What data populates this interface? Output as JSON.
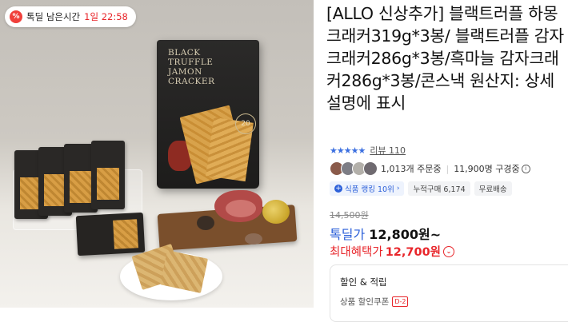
{
  "deal_badge": {
    "icon": "percent-icon",
    "label": "톡딜 남은시간",
    "time": "1일 22:58"
  },
  "product": {
    "title": "[ALLO 신상추가] 블랙트러플 하몽크래커319g*3봉/ 블랙트러플 감자크래커286g*3봉/흑마늘 감자크래커286g*3봉/콘스낵 원산지: 상세설명에 표시",
    "image_text": {
      "bag_title": "BLACK\nTRUFFLE\nJAMON\nCRACKER",
      "seal": "20"
    }
  },
  "rating": {
    "stars": "★★★★★",
    "review_label": "리뷰 110"
  },
  "social": {
    "orders": "1,013개 주문중",
    "browsing": "11,900명 구경중"
  },
  "tags": {
    "ranking": "식품 랭킹 10위",
    "cumulative": "누적구매 6,174",
    "shipping": "무료배송"
  },
  "price": {
    "original": "14,500원",
    "deal_label": "톡딜가",
    "deal_price": "12,800원~",
    "max_label": "최대혜택가",
    "max_price": "12,700원"
  },
  "discount": {
    "header": "할인 & 적립",
    "row_label": "상품 할인쿠폰",
    "dday": "D-2"
  },
  "colors": {
    "accent_red": "#e8262b",
    "accent_blue": "#2b5fd9",
    "star_blue": "#3b6fe0"
  }
}
